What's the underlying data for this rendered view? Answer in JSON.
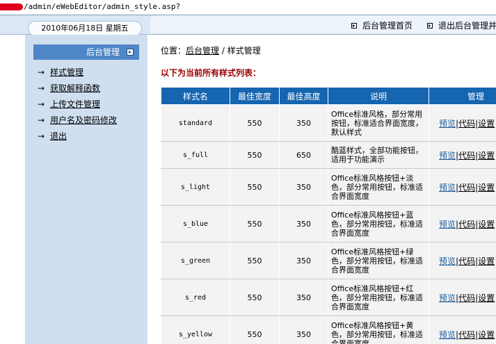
{
  "address": {
    "url": "/admin/eWebEditor/admin_style.asp?"
  },
  "header": {
    "date": "2010年06月18日  星期五",
    "home_link": "后台管理首页",
    "logout_link": "退出后台管理并"
  },
  "sidebar": {
    "title": "后台管理",
    "arrow": "→",
    "items": [
      {
        "label": "样式管理"
      },
      {
        "label": "获取解释函数"
      },
      {
        "label": "上传文件管理"
      },
      {
        "label": "用户名及密码修改"
      },
      {
        "label": "退出"
      }
    ]
  },
  "main": {
    "breadcrumb_prefix": "位置：",
    "breadcrumb_link": "后台管理",
    "breadcrumb_sep": " / ",
    "breadcrumb_current": "样式管理",
    "list_title": "以下为当前所有样式列表：",
    "table": {
      "columns": [
        "样式名",
        "最佳宽度",
        "最佳高度",
        "说明",
        "管理"
      ],
      "action_labels": {
        "preview": "预览",
        "sep": "|",
        "code": "代码",
        "settings": "设置"
      },
      "rows": [
        {
          "name": "standard",
          "width": "550",
          "height": "350",
          "desc": "Office标准风格，部分常用按钮，标准适合界面宽度，默认样式"
        },
        {
          "name": "s_full",
          "width": "550",
          "height": "650",
          "desc": "酷蓝样式，全部功能按钮，适用于功能演示"
        },
        {
          "name": "s_light",
          "width": "550",
          "height": "350",
          "desc": "Office标准风格按钮+淡色，部分常用按钮，标准适合界面宽度"
        },
        {
          "name": "s_blue",
          "width": "550",
          "height": "350",
          "desc": "Office标准风格按钮+蓝色，部分常用按钮，标准适合界面宽度"
        },
        {
          "name": "s_green",
          "width": "550",
          "height": "350",
          "desc": "Office标准风格按钮+绿色，部分常用按钮，标准适合界面宽度"
        },
        {
          "name": "s_red",
          "width": "550",
          "height": "350",
          "desc": "Office标准风格按钮+红色，部分常用按钮，标准适合界面宽度"
        },
        {
          "name": "s_yellow",
          "width": "550",
          "height": "350",
          "desc": "Office标准风格按钮+黄色，部分常用按钮，标准适合界面宽度"
        }
      ]
    }
  },
  "colors": {
    "header_blue": "#1565b0",
    "sidebar_bg": "#cfdff0",
    "sidebar_title": "#4f86c6",
    "list_title": "#990000",
    "redaction": "#e0001b"
  },
  "icons": {
    "home_link_icon": "arrow-square-icon",
    "logout_link_icon": "arrow-square-icon",
    "sidebar_title_icon": "arrow-square-icon",
    "sidebar_item_icon": "right-arrow-icon"
  }
}
